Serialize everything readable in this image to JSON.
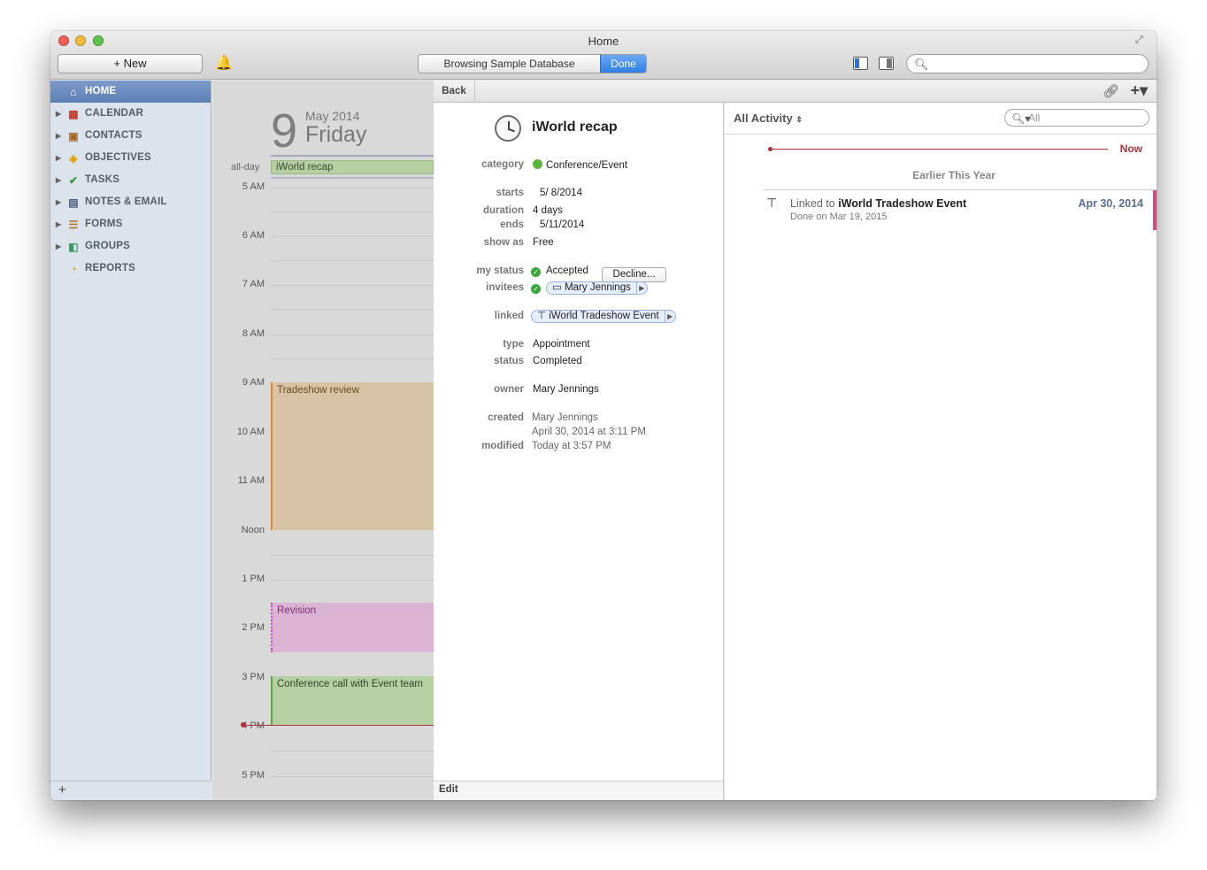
{
  "window": {
    "title": "Home"
  },
  "toolbar": {
    "new_label": "+ New",
    "database_status": "Browsing Sample Database",
    "done_label": "Done",
    "search_placeholder": ""
  },
  "sidebar": {
    "items": [
      {
        "label": "HOME",
        "icon": "house-icon",
        "active": true
      },
      {
        "label": "CALENDAR",
        "icon": "calendar-icon"
      },
      {
        "label": "CONTACTS",
        "icon": "contacts-icon"
      },
      {
        "label": "OBJECTIVES",
        "icon": "objectives-icon"
      },
      {
        "label": "TASKS",
        "icon": "checkmark-icon"
      },
      {
        "label": "NOTES & EMAIL",
        "icon": "notes-icon"
      },
      {
        "label": "FORMS",
        "icon": "forms-icon"
      },
      {
        "label": "GROUPS",
        "icon": "groups-icon"
      },
      {
        "label": "REPORTS",
        "icon": "pie-chart-icon"
      }
    ],
    "add_label": "+"
  },
  "calendar": {
    "day_number": "9",
    "month_year": "May 2014",
    "weekday": "Friday",
    "allday_label": "all-day",
    "allday_event": "iWorld recap",
    "hours": [
      "5 AM",
      "6 AM",
      "7 AM",
      "8 AM",
      "9 AM",
      "10 AM",
      "11 AM",
      "Noon",
      "1 PM",
      "2 PM",
      "3 PM",
      "4 PM",
      "5 PM"
    ],
    "events": [
      {
        "title": "Tradeshow review",
        "color": "#d9c3a6"
      },
      {
        "title": "Revision",
        "color": "#dbb4d5"
      },
      {
        "title": "Conference call with Event team",
        "color": "#b6cfa3"
      }
    ]
  },
  "detail": {
    "back_label": "Back",
    "title": "iWorld recap",
    "labels": {
      "category": "category",
      "starts": "starts",
      "duration": "duration",
      "ends": "ends",
      "show_as": "show as",
      "my_status": "my status",
      "invitees": "invitees",
      "linked": "linked",
      "type": "type",
      "status": "status",
      "owner": "owner",
      "created": "created",
      "modified": "modified"
    },
    "values": {
      "category": "Conference/Event",
      "starts": "5/  8/2014",
      "duration": "4 days",
      "ends": "5/11/2014",
      "show_as": "Free",
      "my_status": "Accepted",
      "decline_label": "Decline...",
      "invitee": "Mary Jennings",
      "linked": "iWorld Tradeshow Event",
      "type": "Appointment",
      "status": "Completed",
      "owner": "Mary Jennings",
      "created_by": "Mary Jennings",
      "created_at": "April 30, 2014 at 3:11 PM",
      "modified": "Today at 3:57 PM"
    },
    "edit_label": "Edit"
  },
  "activity": {
    "filter_label": "All Activity",
    "search_placeholder": "All",
    "now_label": "Now",
    "section_label": "Earlier This Year",
    "entry": {
      "prefix": "Linked to",
      "title": "iWorld Tradeshow Event",
      "sub": "Done on Mar 19, 2015",
      "date": "Apr 30, 2014"
    }
  },
  "colors": {
    "accent": "#2f7ee6",
    "now_line": "#b0313a",
    "sidebar_active": "#5d7fb6"
  }
}
